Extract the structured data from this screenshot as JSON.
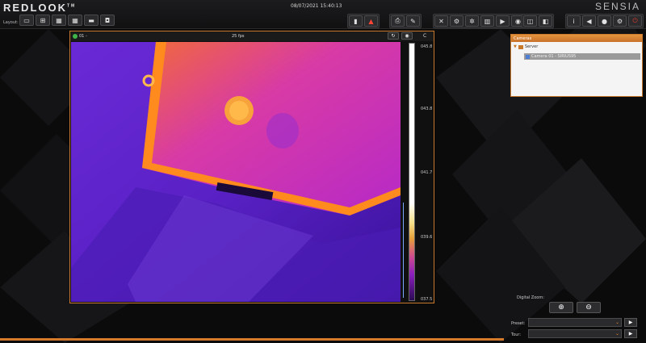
{
  "app": {
    "logo": "REDLOOK",
    "logo_tm": "TM",
    "brand": "SENSIA",
    "datetime": "08/07/2021  15:40:13"
  },
  "toolbar": {
    "layout_label": "Layout:",
    "layout_buttons": [
      "single-view",
      "grid-2x2",
      "grid-3x3",
      "grid-4x4",
      "hide-bar",
      "camera-view"
    ],
    "groups": [
      [
        "alarm-list",
        "alarm-warning"
      ],
      [
        "print-report",
        "eraser"
      ],
      [
        "tools",
        "settings",
        "analysis",
        "bar-chart",
        "playback",
        "database"
      ],
      [
        "layout-left",
        "layout-right"
      ],
      [
        "info",
        "mute",
        "user",
        "config",
        "power"
      ]
    ]
  },
  "video": {
    "camera_id": "01 -",
    "fps": "25 fps",
    "unit": "C",
    "scale_labels": [
      "045.8",
      "043.8",
      "041.7",
      "039.6",
      "037.5"
    ],
    "status_color": "#3fb54a"
  },
  "cameras_panel": {
    "title": "Cameras",
    "server": "Server",
    "camera": "Camera 01 - SIRIUS95"
  },
  "controls": {
    "digital_zoom_label": "Digital Zoom:",
    "zoom_in": "⊕",
    "zoom_out": "⊖",
    "preset_label": "Preset:",
    "preset_value": "",
    "tour_label": "Tour:",
    "tour_value": ""
  },
  "colors": {
    "accent": "#d57a2a",
    "alarm": "#e23b2e"
  }
}
